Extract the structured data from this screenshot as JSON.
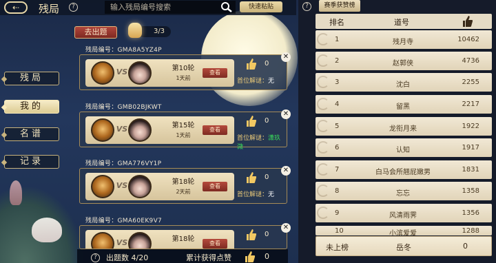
{
  "header": {
    "title": "残局",
    "search_placeholder": "输入残局编号搜索",
    "paste_label": "快速粘贴"
  },
  "sidebar": {
    "items": [
      {
        "label": "残局",
        "active": false
      },
      {
        "label": "我的",
        "active": true
      },
      {
        "label": "名谱",
        "active": false
      },
      {
        "label": "记录",
        "active": false
      }
    ]
  },
  "main": {
    "submit_button": "去出题",
    "count": "3/3",
    "id_label": "残局编号：",
    "puzzles": [
      {
        "id": "GMA8A5YZ4P",
        "round": "第10轮",
        "ago": "1天前",
        "view": "查看",
        "likes": "0",
        "first_label": "首位解谜：",
        "first_solver": "无"
      },
      {
        "id": "GMB02BJKWT",
        "round": "第15轮",
        "ago": "1天前",
        "view": "查看",
        "likes": "0",
        "first_label": "首位解谜：",
        "first_solver": "潇玖溦"
      },
      {
        "id": "GMA776VY1P",
        "round": "第18轮",
        "ago": "2天前",
        "view": "查看",
        "likes": "0",
        "first_label": "首位解谜：",
        "first_solver": "无"
      },
      {
        "id": "GMA60EK9V7",
        "round": "第18轮",
        "ago": "",
        "view": "查看",
        "likes": "0",
        "first_label": "",
        "first_solver": ""
      }
    ],
    "bottom": {
      "count": "出题数 4/20",
      "likes_label": "累计获得点赞",
      "likes_value": "0"
    }
  },
  "leaderboard": {
    "season_label": "赛季获赞榜",
    "col_rank": "排名",
    "col_name": "道号",
    "rows": [
      {
        "rank": "1",
        "name": "残月寺",
        "score": "10462"
      },
      {
        "rank": "2",
        "name": "赵郭侠",
        "score": "4736"
      },
      {
        "rank": "3",
        "name": "沈白",
        "score": "2255"
      },
      {
        "rank": "4",
        "name": "留黑",
        "score": "2217"
      },
      {
        "rank": "5",
        "name": "龙衔月来",
        "score": "1922"
      },
      {
        "rank": "6",
        "name": "认知",
        "score": "1917"
      },
      {
        "rank": "7",
        "name": "白马会所翘屁嫩男",
        "score": "1831"
      },
      {
        "rank": "8",
        "name": "忘忘",
        "score": "1358"
      },
      {
        "rank": "9",
        "name": "风清雨霁",
        "score": "1356"
      },
      {
        "rank": "10",
        "name": "小滨爱爱",
        "score": "1288"
      }
    ],
    "my_row": {
      "rank": "未上榜",
      "name": "岳冬",
      "score": "0"
    }
  }
}
